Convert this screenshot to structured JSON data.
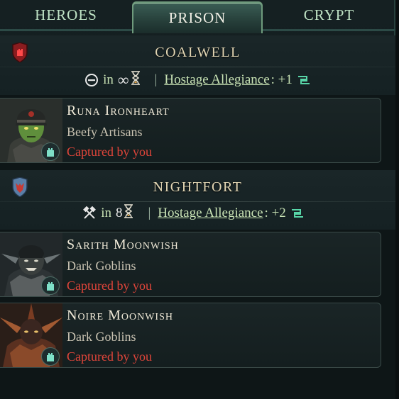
{
  "tabs": [
    {
      "label": "HEROES",
      "active": false
    },
    {
      "label": "PRISON",
      "active": true
    },
    {
      "label": "CRYPT",
      "active": false
    }
  ],
  "sections": [
    {
      "name": "COALWELL",
      "shield_color": "#c0282c",
      "turn_icon": "minus-circle-icon",
      "in_label": "in",
      "turns": "∞",
      "allegiance_label": "Hostage Allegiance",
      "allegiance_value": ": +1",
      "heroes": [
        {
          "name": "Runa Ironheart",
          "faction": "Beefy Artisans",
          "status": "Captured by you"
        }
      ]
    },
    {
      "name": "NIGHTFORT",
      "shield_color": "#3b6fb0",
      "turn_icon": "crossed-hammers-icon",
      "in_label": "in",
      "turns": "8",
      "allegiance_label": "Hostage Allegiance",
      "allegiance_value": ": +2",
      "heroes": [
        {
          "name": "Sarith Moonwish",
          "faction": "Dark Goblins",
          "status": "Captured by you"
        },
        {
          "name": "Noire Moonwish",
          "faction": "Dark Goblins",
          "status": "Captured by you"
        }
      ]
    }
  ],
  "colors": {
    "accent_green": "#c8e2b4",
    "captured_red": "#e0453a",
    "tab_active_border": "#6e9a7c"
  }
}
